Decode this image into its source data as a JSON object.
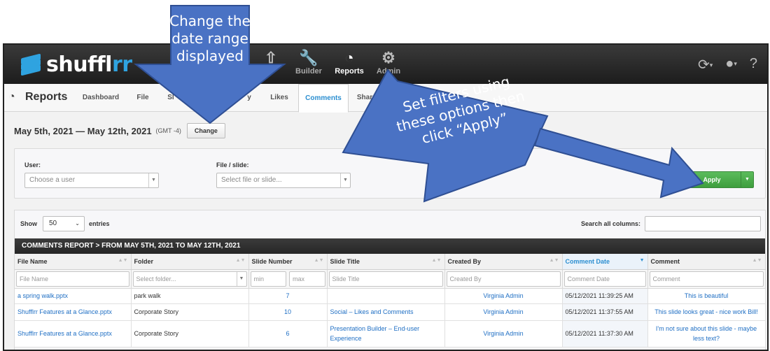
{
  "logo": {
    "text_main": "shuffl",
    "text_accent": "rr"
  },
  "topnav": {
    "items": [
      {
        "label": "",
        "icon": "upload-icon"
      },
      {
        "label": "Builder",
        "icon": "wrench-icon"
      },
      {
        "label": "Reports",
        "icon": "pie-chart-icon"
      },
      {
        "label": "Admin",
        "icon": "gear-icon"
      }
    ],
    "right_icons": [
      "sync-icon",
      "user-icon",
      "help-icon"
    ]
  },
  "subnav": {
    "title": "Reports",
    "tabs": [
      "Dashboard",
      "File",
      "Sl",
      "y",
      "Likes",
      "Comments",
      "Shar",
      "Pres"
    ]
  },
  "date_row": {
    "range": "May 5th, 2021 — May 12th, 2021",
    "tz": "(GMT -4)",
    "change_label": "Change"
  },
  "filters": {
    "user_label": "User:",
    "user_placeholder": "Choose a user",
    "file_label": "File / slide:",
    "file_placeholder": "Select file or slide...",
    "apply_label": "Apply"
  },
  "table_controls": {
    "show_label": "Show",
    "entries_value": "50",
    "entries_label": "entries",
    "search_label": "Search all columns:"
  },
  "report_header": "COMMENTS REPORT  >  FROM MAY 5TH, 2021 TO MAY 12TH, 2021",
  "columns": [
    "File Name",
    "Folder",
    "Slide Number",
    "Slide Title",
    "Created By",
    "Comment Date",
    "Comment"
  ],
  "column_filters": {
    "file_name": "File Name",
    "folder": "Select folder...",
    "min": "min",
    "max": "max",
    "slide_title": "Slide Title",
    "created_by": "Created By",
    "comment_date": "Comment Date",
    "comment": "Comment"
  },
  "rows": [
    {
      "file": "a spring walk.pptx",
      "folder": "park walk",
      "slide": "7",
      "title": "",
      "by": "Virginia Admin",
      "date": "05/12/2021 11:39:25 AM",
      "comment": "This is beautiful"
    },
    {
      "file": "Shufflrr Features at a Glance.pptx",
      "folder": "Corporate Story",
      "slide": "10",
      "title": "Social – Likes and Comments",
      "by": "Virginia Admin",
      "date": "05/12/2021 11:37:55 AM",
      "comment": "This slide looks great - nice work Bill!"
    },
    {
      "file": "Shufflrr Features at a Glance.pptx",
      "folder": "Corporate Story",
      "slide": "6",
      "title": "Presentation Builder – End-user Experience",
      "by": "Virginia Admin",
      "date": "05/12/2021 11:37:30 AM",
      "comment": "I'm not sure about this slide - maybe less text?"
    }
  ],
  "annotations": {
    "top": "Change the date range displayed",
    "right": "Set filters using these options then click “Apply”"
  },
  "colors": {
    "accent": "#2fa3e0",
    "apply_green": "#4cae4c",
    "annotation_blue": "#4a72c4",
    "link": "#1f6fc4"
  }
}
